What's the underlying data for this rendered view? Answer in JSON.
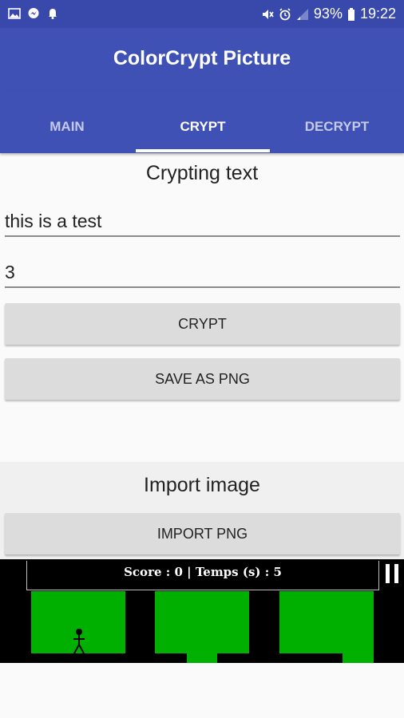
{
  "status_bar": {
    "battery_pct": "93%",
    "time": "19:22",
    "left_icons": [
      "gallery-icon",
      "messenger-icon",
      "notification-icon"
    ],
    "right_icons": [
      "mute-icon",
      "alarm-icon",
      "signal-icon",
      "battery-icon"
    ]
  },
  "app": {
    "title": "ColorCrypt Picture",
    "primary_color": "#3f51b5",
    "status_color": "#3949ab"
  },
  "tabs": [
    {
      "label": "MAIN",
      "active": false
    },
    {
      "label": "CRYPT",
      "active": true
    },
    {
      "label": "DECRYPT",
      "active": false
    }
  ],
  "crypt": {
    "heading": "Crypting text",
    "text_value": "this is a test",
    "key_value": "3",
    "crypt_button": "CRYPT",
    "save_button": "SAVE AS PNG"
  },
  "import": {
    "heading": "Import image",
    "import_button": "IMPORT PNG"
  },
  "game": {
    "hud_text": "Score : 0 | Temps (s) : 5",
    "block_color": "#00b000"
  }
}
